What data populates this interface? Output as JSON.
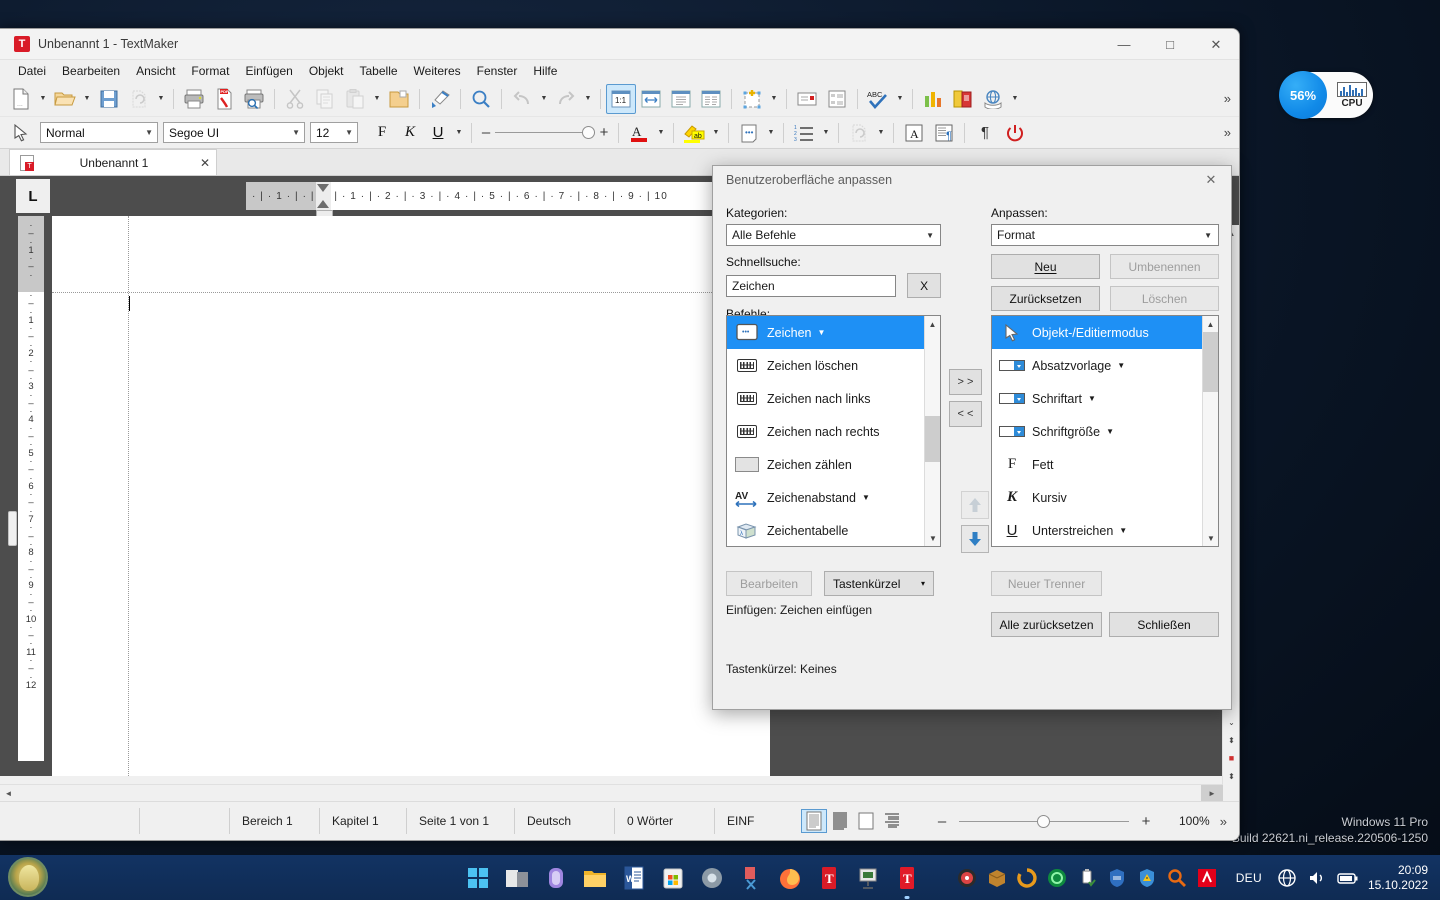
{
  "desktop": {
    "watermark_line1": "Windows 11 Pro",
    "watermark_line2": "Build 22621.ni_release.220506-1250"
  },
  "cpu_widget": {
    "percent": "56%",
    "label": "CPU",
    "icon": "cpu-graph-icon"
  },
  "window": {
    "title": "Unbenannt 1 - TextMaker",
    "app_icon": "T",
    "controls": {
      "minimize": "—",
      "maximize": "□",
      "close": "✕"
    }
  },
  "menubar": {
    "items": [
      {
        "label": "Datei"
      },
      {
        "label": "Bearbeiten"
      },
      {
        "label": "Ansicht"
      },
      {
        "label": "Format"
      },
      {
        "label": "Einfügen"
      },
      {
        "label": "Objekt"
      },
      {
        "label": "Tabelle"
      },
      {
        "label": "Weiteres"
      },
      {
        "label": "Fenster"
      },
      {
        "label": "Hilfe"
      }
    ]
  },
  "toolbar_main": {
    "overflow_label": "»",
    "items": [
      {
        "name": "new-document-icon",
        "caret": true
      },
      {
        "name": "open-file-icon",
        "caret": true
      },
      {
        "name": "save-icon",
        "caret": false
      },
      {
        "name": "restore-icon",
        "caret": true,
        "disabled": true
      },
      {
        "name": "print-icon",
        "caret": false
      },
      {
        "name": "export-pdf-icon",
        "caret": false
      },
      {
        "name": "print-preview-icon",
        "caret": false
      },
      {
        "name": "cut-icon",
        "caret": false,
        "disabled": true
      },
      {
        "name": "copy-icon",
        "caret": false,
        "disabled": true
      },
      {
        "name": "paste-icon",
        "caret": true,
        "disabled": true
      },
      {
        "name": "folder-icon",
        "caret": false
      },
      {
        "name": "format-painter-icon",
        "caret": false
      },
      {
        "name": "search-icon",
        "caret": false
      },
      {
        "name": "undo-icon",
        "caret": true,
        "disabled": true
      },
      {
        "name": "redo-icon",
        "caret": true,
        "disabled": true
      },
      {
        "name": "zoom-100-icon",
        "caret": false,
        "label": "1:1",
        "active": true
      },
      {
        "name": "page-width-icon",
        "caret": false
      },
      {
        "name": "single-page-icon",
        "caret": false
      },
      {
        "name": "multi-page-icon",
        "caret": false
      },
      {
        "name": "insert-object-icon",
        "caret": true
      },
      {
        "name": "insert-frame-icon",
        "caret": false
      },
      {
        "name": "insert-table-icon",
        "caret": false
      },
      {
        "name": "spellcheck-icon",
        "caret": true
      },
      {
        "name": "chart-icon",
        "caret": false
      },
      {
        "name": "books-icon",
        "caret": false
      },
      {
        "name": "internet-icon",
        "caret": true
      }
    ]
  },
  "toolbar_format": {
    "overflow_label": "»",
    "cursor_mode_icon": "pointer-icon",
    "paragraph_style": {
      "value": "Normal"
    },
    "font_family": {
      "value": "Segoe UI"
    },
    "font_size": {
      "value": "12"
    },
    "bold_label": "F",
    "italic_label": "K",
    "underline_label": "U",
    "zoom_minus": "–",
    "zoom_plus": "+",
    "items": [
      {
        "name": "font-color-icon",
        "caret": true
      },
      {
        "name": "highlight-color-icon",
        "caret": true
      },
      {
        "name": "character-icon",
        "caret": true
      },
      {
        "name": "numbered-list-icon",
        "caret": true
      },
      {
        "name": "restore-format-icon",
        "caret": true,
        "disabled": true
      },
      {
        "name": "text-frame-icon",
        "caret": false
      },
      {
        "name": "paragraph-format-icon",
        "caret": false
      },
      {
        "name": "show-marks-icon",
        "caret": false
      },
      {
        "name": "power-icon",
        "caret": false
      }
    ]
  },
  "document_tab": {
    "label": "Unbenannt 1",
    "close_label": "✕",
    "icon": "document-icon"
  },
  "ruler": {
    "corner_tab_stop": "L",
    "horizontal_ticks": "· | · 1 · | · |  | · | · 1 · | · 2 · | · 3 · | · 4 · | · 5 · | · 6 · | · 7 · | · 8 · | · 9 · |  10",
    "vertical_labels": [
      "1",
      "1",
      "2",
      "3",
      "4",
      "5",
      "6",
      "7",
      "8",
      "9",
      "10",
      "11",
      "12"
    ]
  },
  "statusbar": {
    "section": "Bereich 1",
    "chapter": "Kapitel 1",
    "page": "Seite 1 von 1",
    "language": "Deutsch",
    "words": "0 Wörter",
    "insert_mode": "EINF",
    "zoom_percent": "100%",
    "zoom_minus": "–",
    "zoom_plus": "+",
    "overflow_label": "»",
    "view_buttons": [
      {
        "name": "normal-view-icon",
        "active": true
      },
      {
        "name": "page-layout-view-icon",
        "active": false
      },
      {
        "name": "print-preview-view-icon",
        "active": false
      },
      {
        "name": "outline-view-icon",
        "active": false
      }
    ]
  },
  "dialog": {
    "title": "Benutzeroberfläche anpassen",
    "close_label": "✕",
    "left": {
      "categories_label": "Kategorien:",
      "categories_value": "Alle Befehle",
      "quicksearch_label": "Schnellsuche:",
      "quicksearch_value": "Zeichen",
      "clear_button": "X",
      "commands_label": "Befehle:",
      "commands": [
        {
          "label": "Zeichen",
          "icon": "character-keyboard-icon",
          "dropdown": true,
          "selected": true
        },
        {
          "label": "Zeichen löschen",
          "icon": "keyboard-icon",
          "dropdown": false,
          "selected": false
        },
        {
          "label": "Zeichen nach links",
          "icon": "keyboard-icon",
          "dropdown": false,
          "selected": false
        },
        {
          "label": "Zeichen nach rechts",
          "icon": "keyboard-icon",
          "dropdown": false,
          "selected": false
        },
        {
          "label": "Zeichen zählen",
          "icon": "box-icon",
          "dropdown": false,
          "selected": false
        },
        {
          "label": "Zeichenabstand",
          "icon": "av-spacing-icon",
          "dropdown": true,
          "selected": false
        },
        {
          "label": "Zeichentabelle",
          "icon": "character-table-icon",
          "dropdown": false,
          "selected": false
        }
      ],
      "edit_button": "Bearbeiten",
      "shortcut_button": "Tastenkürzel",
      "shortcut_button_caret": "▾",
      "insert_info": "Einfügen: Zeichen einfügen"
    },
    "middle": {
      "add_button": "> >",
      "remove_button": "< <",
      "move_up_icon": "arrow-up-icon",
      "move_down_icon": "arrow-down-icon"
    },
    "right": {
      "customize_label": "Anpassen:",
      "customize_value": "Format",
      "new_button": "Neu",
      "rename_button": "Umbenennen",
      "reset_button": "Zurücksetzen",
      "delete_button": "Löschen",
      "entries": [
        {
          "label": "Objekt-/Editiermodus",
          "icon": "pointer-icon",
          "dropdown": false,
          "selected": true
        },
        {
          "label": "Absatzvorlage",
          "icon": "combobox-icon",
          "dropdown": true,
          "selected": false
        },
        {
          "label": "Schriftart",
          "icon": "combobox-icon",
          "dropdown": true,
          "selected": false
        },
        {
          "label": "Schriftgröße",
          "icon": "combobox-icon",
          "dropdown": true,
          "selected": false
        },
        {
          "label": "Fett",
          "icon": "bold-icon",
          "dropdown": false,
          "selected": false
        },
        {
          "label": "Kursiv",
          "icon": "italic-icon",
          "dropdown": false,
          "selected": false
        },
        {
          "label": "Unterstreichen",
          "icon": "underline-icon",
          "dropdown": true,
          "selected": false
        }
      ],
      "new_separator_button": "Neuer Trenner",
      "reset_all_button": "Alle zurücksetzen",
      "close_button": "Schließen"
    },
    "shortcut_info": "Tastenkürzel: Keines"
  },
  "tray": {
    "language": "DEU",
    "time": "20:09",
    "date": "15.10.2022",
    "icons": [
      "speedfan-icon",
      "package-icon",
      "sync-icon",
      "teamviewer-icon",
      "usb-safely-remove-icon",
      "firewall-icon",
      "defender-warning-icon",
      "everything-search-icon",
      "avira-icon"
    ],
    "system_icons": [
      "network-icon",
      "volume-icon",
      "battery-icon"
    ]
  },
  "taskbar": {
    "items": [
      {
        "name": "start-button-icon"
      },
      {
        "name": "task-view-icon"
      },
      {
        "name": "widgets-icon"
      },
      {
        "name": "file-explorer-icon"
      },
      {
        "name": "word-icon"
      },
      {
        "name": "microsoft-store-icon"
      },
      {
        "name": "settings-icon"
      },
      {
        "name": "snipping-tool-icon"
      },
      {
        "name": "firefox-icon"
      },
      {
        "name": "textmaker-icon"
      },
      {
        "name": "presentations-icon"
      },
      {
        "name": "textmaker-active-icon",
        "active": true
      }
    ]
  }
}
